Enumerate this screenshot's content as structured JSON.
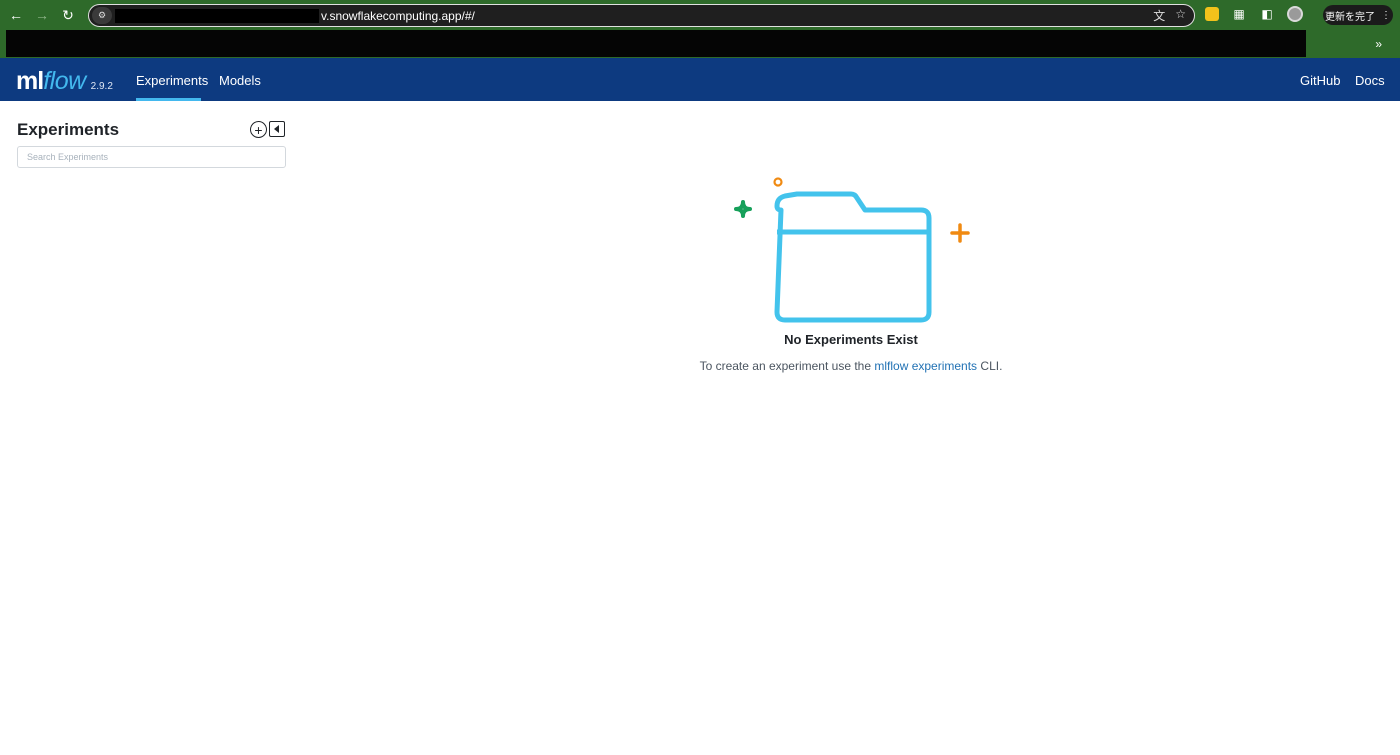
{
  "browser": {
    "url_visible": "v.snowflakecomputing.app/#/",
    "update_button_label": "更新を完了",
    "menu_glyph": "⋮",
    "bookmarks_more": "»",
    "icons": {
      "back": "back-arrow-icon",
      "forward": "forward-arrow-icon",
      "reload": "reload-icon",
      "site_info": "site-info-icon",
      "translate": "translate-icon",
      "bookmark": "star-icon",
      "extension": "extension-icon",
      "puzzle": "extensions-puzzle-icon",
      "side_panel": "side-panel-icon",
      "profile": "profile-avatar"
    },
    "colors": {
      "frame": "#2e6a2a",
      "omnibox": "#1f1f1f"
    }
  },
  "header": {
    "logo_ml": "ml",
    "logo_flow": "flow",
    "version": "2.9.2",
    "nav": {
      "experiments": "Experiments",
      "models": "Models",
      "github": "GitHub",
      "docs": "Docs"
    },
    "colors": {
      "background": "#0d3a80",
      "accent": "#43b8ee"
    }
  },
  "sidebar": {
    "title": "Experiments",
    "search_placeholder": "Search Experiments",
    "icons": {
      "add": "add-circle-icon",
      "collapse": "collapse-sidebar-icon"
    }
  },
  "empty_state": {
    "title": "No Experiments Exist",
    "description_prefix": "To create an experiment use the ",
    "description_link": "mlflow experiments",
    "description_suffix": " CLI.",
    "illustration": "empty-folder-icon",
    "colors": {
      "folder": "#43c3ec",
      "sparkle_green": "#16a05a",
      "sparkle_orange": "#f08a12"
    }
  }
}
